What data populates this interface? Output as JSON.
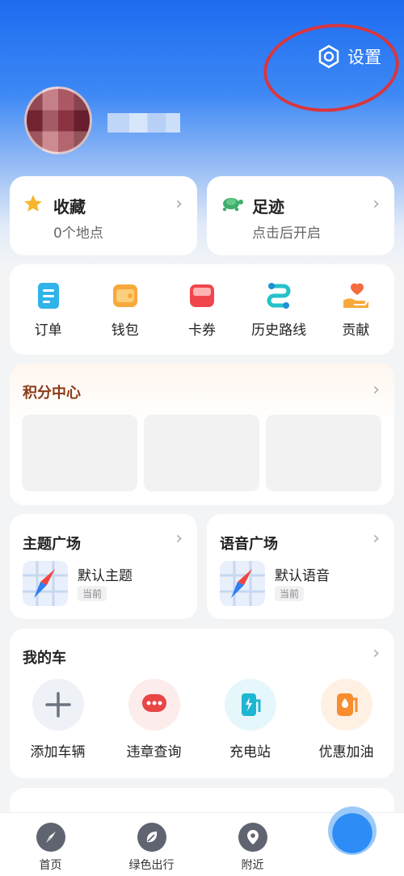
{
  "header": {
    "settings_label": "设置"
  },
  "favorites": {
    "title": "收藏",
    "subtitle": "0个地点"
  },
  "footprints": {
    "title": "足迹",
    "subtitle": "点击后开启"
  },
  "shortcuts": [
    {
      "label": "订单",
      "icon": "order-icon"
    },
    {
      "label": "钱包",
      "icon": "wallet-icon"
    },
    {
      "label": "卡券",
      "icon": "coupon-icon"
    },
    {
      "label": "历史路线",
      "icon": "route-history-icon"
    },
    {
      "label": "贡献",
      "icon": "contribution-icon"
    }
  ],
  "points_center": {
    "title": "积分中心"
  },
  "theme_plaza": {
    "title": "主题广场",
    "item": "默认主题",
    "badge": "当前"
  },
  "voice_plaza": {
    "title": "语音广场",
    "item": "默认语音",
    "badge": "当前"
  },
  "my_car": {
    "title": "我的车",
    "items": [
      {
        "label": "添加车辆",
        "icon": "add-icon"
      },
      {
        "label": "违章查询",
        "icon": "violation-icon"
      },
      {
        "label": "充电站",
        "icon": "charging-station-icon"
      },
      {
        "label": "优惠加油",
        "icon": "fuel-icon"
      }
    ]
  },
  "tabbar": [
    {
      "label": "首页",
      "icon": "compass-icon"
    },
    {
      "label": "绿色出行",
      "icon": "leaf-icon"
    },
    {
      "label": "附近",
      "icon": "location-pin-icon"
    }
  ],
  "colors": {
    "accent": "#1d6cf0",
    "annotation": "#d9363e"
  }
}
